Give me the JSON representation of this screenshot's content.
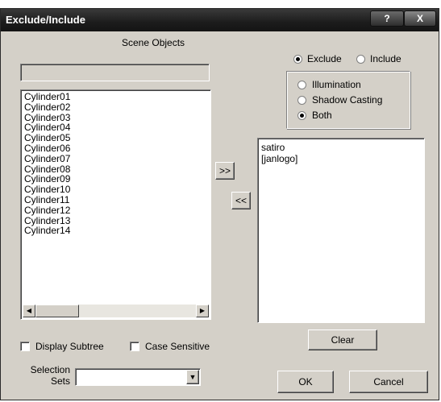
{
  "window": {
    "title": "Exclude/Include",
    "help_label": "?",
    "close_label": "X"
  },
  "scene_objects": {
    "heading": "Scene Objects",
    "search_value": "",
    "items": [
      "Cylinder01",
      "Cylinder02",
      "Cylinder03",
      "Cylinder04",
      "Cylinder05",
      "Cylinder06",
      "Cylinder07",
      "Cylinder08",
      "Cylinder09",
      "Cylinder10",
      "Cylinder11",
      "Cylinder12",
      "Cylinder13",
      "Cylinder14"
    ],
    "scroll_left_icon": "left-arrow",
    "scroll_right_icon": "right-arrow"
  },
  "transfer": {
    "add_label": ">>",
    "remove_label": "<<"
  },
  "mode": {
    "exclude_label": "Exclude",
    "include_label": "Include",
    "selected": "Exclude"
  },
  "affect": {
    "illumination_label": "Illumination",
    "shadow_casting_label": "Shadow Casting",
    "both_label": "Both",
    "selected": "Both"
  },
  "excluded_list": {
    "items": [
      "satiro",
      "[janlogo]"
    ]
  },
  "options": {
    "display_subtree_label": "Display Subtree",
    "display_subtree_checked": false,
    "case_sensitive_label": "Case Sensitive",
    "case_sensitive_checked": false
  },
  "selection_sets": {
    "label_line1": "Selection",
    "label_line2": "Sets",
    "value": "",
    "dropdown_icon": "dropdown-arrow"
  },
  "buttons": {
    "clear_label": "Clear",
    "ok_label": "OK",
    "cancel_label": "Cancel"
  }
}
